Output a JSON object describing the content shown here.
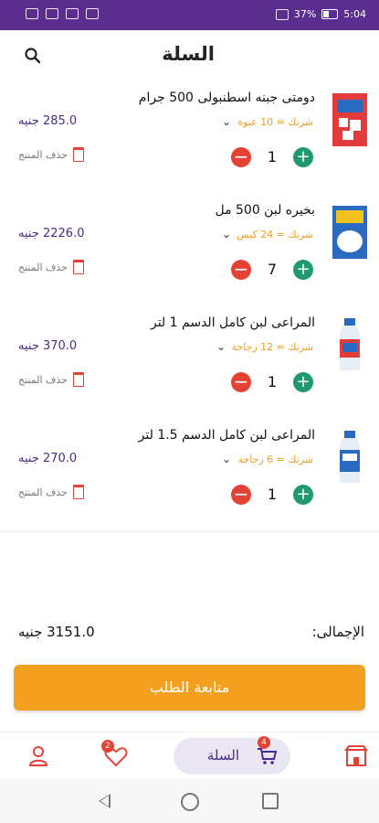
{
  "status_bar": {
    "battery": "37%",
    "time": "5:04"
  },
  "header": {
    "title": "السلة"
  },
  "cart_items": [
    {
      "name": "دومتى جبنه اسطنبولى 500 جرام",
      "pack": "شرنك = 10 عبوة",
      "price": "285.0 جنيه",
      "qty": "1",
      "delete_label": "حذف المنتج"
    },
    {
      "name": "بخيره لبن 500 مل",
      "pack": "شرنك = 24 كيس",
      "price": "2226.0 جنيه",
      "qty": "7",
      "delete_label": "حذف المنتج"
    },
    {
      "name": "المراعى لبن كامل الدسم 1 لتر",
      "pack": "شرنك = 12 زجاجة",
      "price": "370.0 جنيه",
      "qty": "1",
      "delete_label": "حذف المنتج"
    },
    {
      "name": "المراعى لبن كامل الدسم 1.5 لتر",
      "pack": "شرنك = 6 زجاجة",
      "price": "270.0 جنيه",
      "qty": "1",
      "delete_label": "حذف المنتج"
    }
  ],
  "summary": {
    "total_label": "الإجمالى:",
    "total_value": "3151.0 جنيه"
  },
  "checkout_label": "متابعة الطلب",
  "tabbar": {
    "cart_label": "السلة",
    "cart_badge": "4",
    "wishlist_badge": "2"
  },
  "colors": {
    "primary": "#5b2d8e",
    "accent": "#f4a01f",
    "plus": "#1f9a6f",
    "minus": "#e64234"
  },
  "icons": [
    "search-icon",
    "chevron-down-icon",
    "trash-icon",
    "user-icon",
    "heart-icon",
    "cart-icon",
    "store-icon"
  ]
}
